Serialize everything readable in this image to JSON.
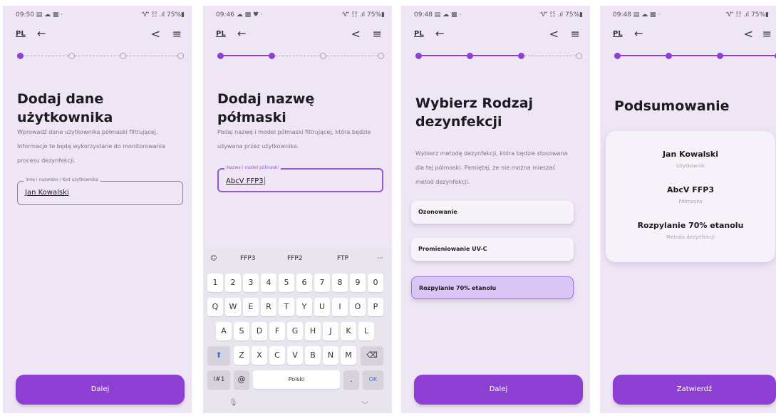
{
  "common": {
    "lang": "PL",
    "back_glyph": "←",
    "share_glyph": "<",
    "menu_glyph": "≡",
    "status_sys": "Ꮙ ☷ .ıl 75%▮"
  },
  "screens": [
    {
      "time": "09:50 ▤ ☁ ▩ ·",
      "title": "Dodaj dane użytkownika",
      "desc_lines": [
        "Wprowadź dane użytkownika półmaski filtrującej.",
        "Informacje te będą wykorzystane do monitorowania",
        "procesu dezynfekcji."
      ],
      "field_label": "Imię i nazwisko / Kod użytkownika",
      "field_value": "Jan Kowalski",
      "button": "Dalej",
      "progress_step": 1
    },
    {
      "time": "09:46 ☁ ▩ ♥ ·",
      "title": "Dodaj nazwę półmaski",
      "desc_lines": [
        "Podaj nazwę i model półmaski filtrującej, która będzie",
        "używana przez użytkownika."
      ],
      "field_label": "Nazwa i model półmaski",
      "field_value": "AbcV FFP3",
      "keyboard": {
        "suggestions": [
          "FFP3",
          "FFP2",
          "FTP",
          "···"
        ],
        "sticker_glyph": "☺",
        "digits": [
          "1",
          "2",
          "3",
          "4",
          "5",
          "6",
          "7",
          "8",
          "9",
          "0"
        ],
        "row1": [
          "Q",
          "W",
          "E",
          "R",
          "T",
          "Y",
          "U",
          "I",
          "O",
          "P"
        ],
        "row2": [
          "A",
          "S",
          "D",
          "F",
          "G",
          "H",
          "J",
          "K",
          "L"
        ],
        "row3": [
          "Z",
          "X",
          "C",
          "V",
          "B",
          "N",
          "M"
        ],
        "shift_glyph": "⬆",
        "backspace_glyph": "⌫",
        "sym": "!#1",
        "at": "@",
        "space": "Polski",
        "dot": ".",
        "ok": "OK",
        "mic_glyph": "🎙",
        "hide_glyph": "﹀"
      },
      "progress_step": 2
    },
    {
      "time": "09:48 ▤ ☁ ▩ ·",
      "title_lines": [
        "Wybierz Rodzaj",
        "dezynfekcji"
      ],
      "desc_lines": [
        "Wybierz metodę dezynfekcji, która będzie stosowana",
        "dla tej półmaski. Pamiętaj, że nie można mieszać",
        "metod dezynfekcji."
      ],
      "options": [
        "Ozonowanie",
        "Promieniowanie UV-C",
        "Rozpylanie 70% etanolu"
      ],
      "selected_option": 2,
      "button": "Dalej",
      "progress_step": 3
    },
    {
      "time": "09:48 ▤ ☁ ▩ ·",
      "title": "Podsumowanie",
      "summary": [
        {
          "value": "Jan Kowalski",
          "label": "Użytkownik"
        },
        {
          "value": "AbcV FFP3",
          "label": "Półmaska"
        },
        {
          "value": "Rozpylanie 70% etanolu",
          "label": "Metoda dezynfekcji"
        }
      ],
      "button": "Zatwierdź",
      "progress_step": 4
    }
  ]
}
